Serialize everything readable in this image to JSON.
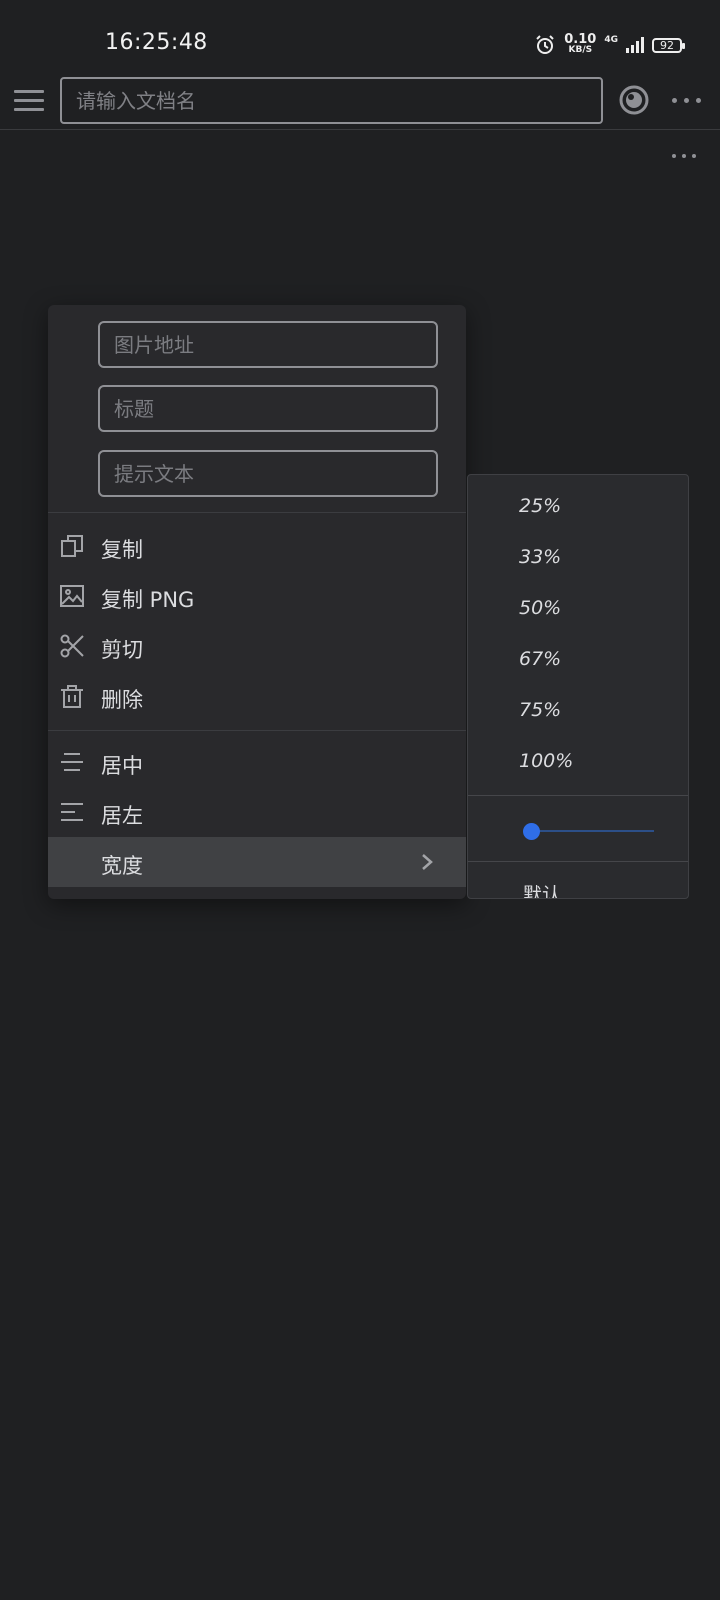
{
  "status_bar": {
    "time": "16:25:48",
    "net_speed_value": "0.10",
    "net_speed_unit": "KB/S",
    "network_type": "4G",
    "battery": "92"
  },
  "top_bar": {
    "search_placeholder": "请输入文档名"
  },
  "image_menu": {
    "fields": {
      "image_url_placeholder": "图片地址",
      "title_placeholder": "标题",
      "alt_text_placeholder": "提示文本"
    },
    "items": {
      "copy": "复制",
      "copy_png": "复制 PNG",
      "cut": "剪切",
      "delete": "删除",
      "align_center": "居中",
      "align_left": "居左",
      "width": "宽度"
    }
  },
  "width_submenu": {
    "options": [
      "25%",
      "33%",
      "50%",
      "67%",
      "75%",
      "100%"
    ],
    "slider_value_fraction": 0.0,
    "default_label": "默认"
  },
  "colors": {
    "background": "#1f2022",
    "menu_background": "#29292c",
    "accent": "#2f6ee8"
  }
}
